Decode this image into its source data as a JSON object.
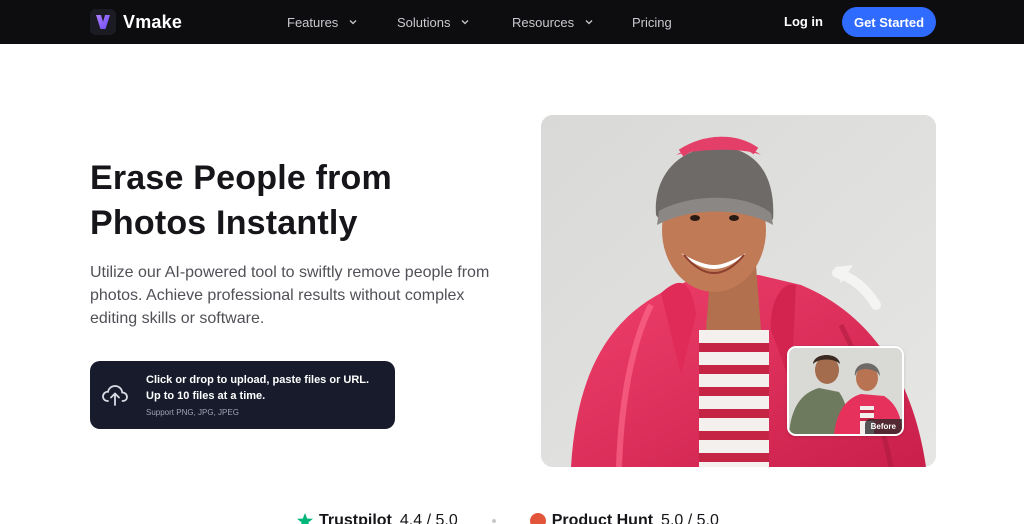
{
  "nav": {
    "brand": "Vmake",
    "menu": [
      "Features",
      "Solutions",
      "Resources",
      "Pricing"
    ],
    "login": "Log in",
    "cta": "Get Started"
  },
  "hero": {
    "title_line1": "Erase People from",
    "title_line2": "Photos Instantly",
    "description": "Utilize our AI-powered tool to swiftly remove people from photos. Achieve professional results without complex editing skills or software.",
    "upload_main": "Click or drop to upload, paste files or URL. Up to 10 files at a time.",
    "upload_sub": "Support PNG, JPG, JPEG",
    "before_label": "Before"
  },
  "ratings": {
    "trustpilot": "Trustpilot",
    "trustpilot_score": "4.4 / 5.0",
    "producthunt": "Product Hunt",
    "producthunt_score": "5.0 / 5.0"
  },
  "colors": {
    "nav_bg": "#0d0d0f",
    "cta_bg": "#2f6bff",
    "upload_bg": "#171b2b",
    "jacket": "#e6315c"
  }
}
